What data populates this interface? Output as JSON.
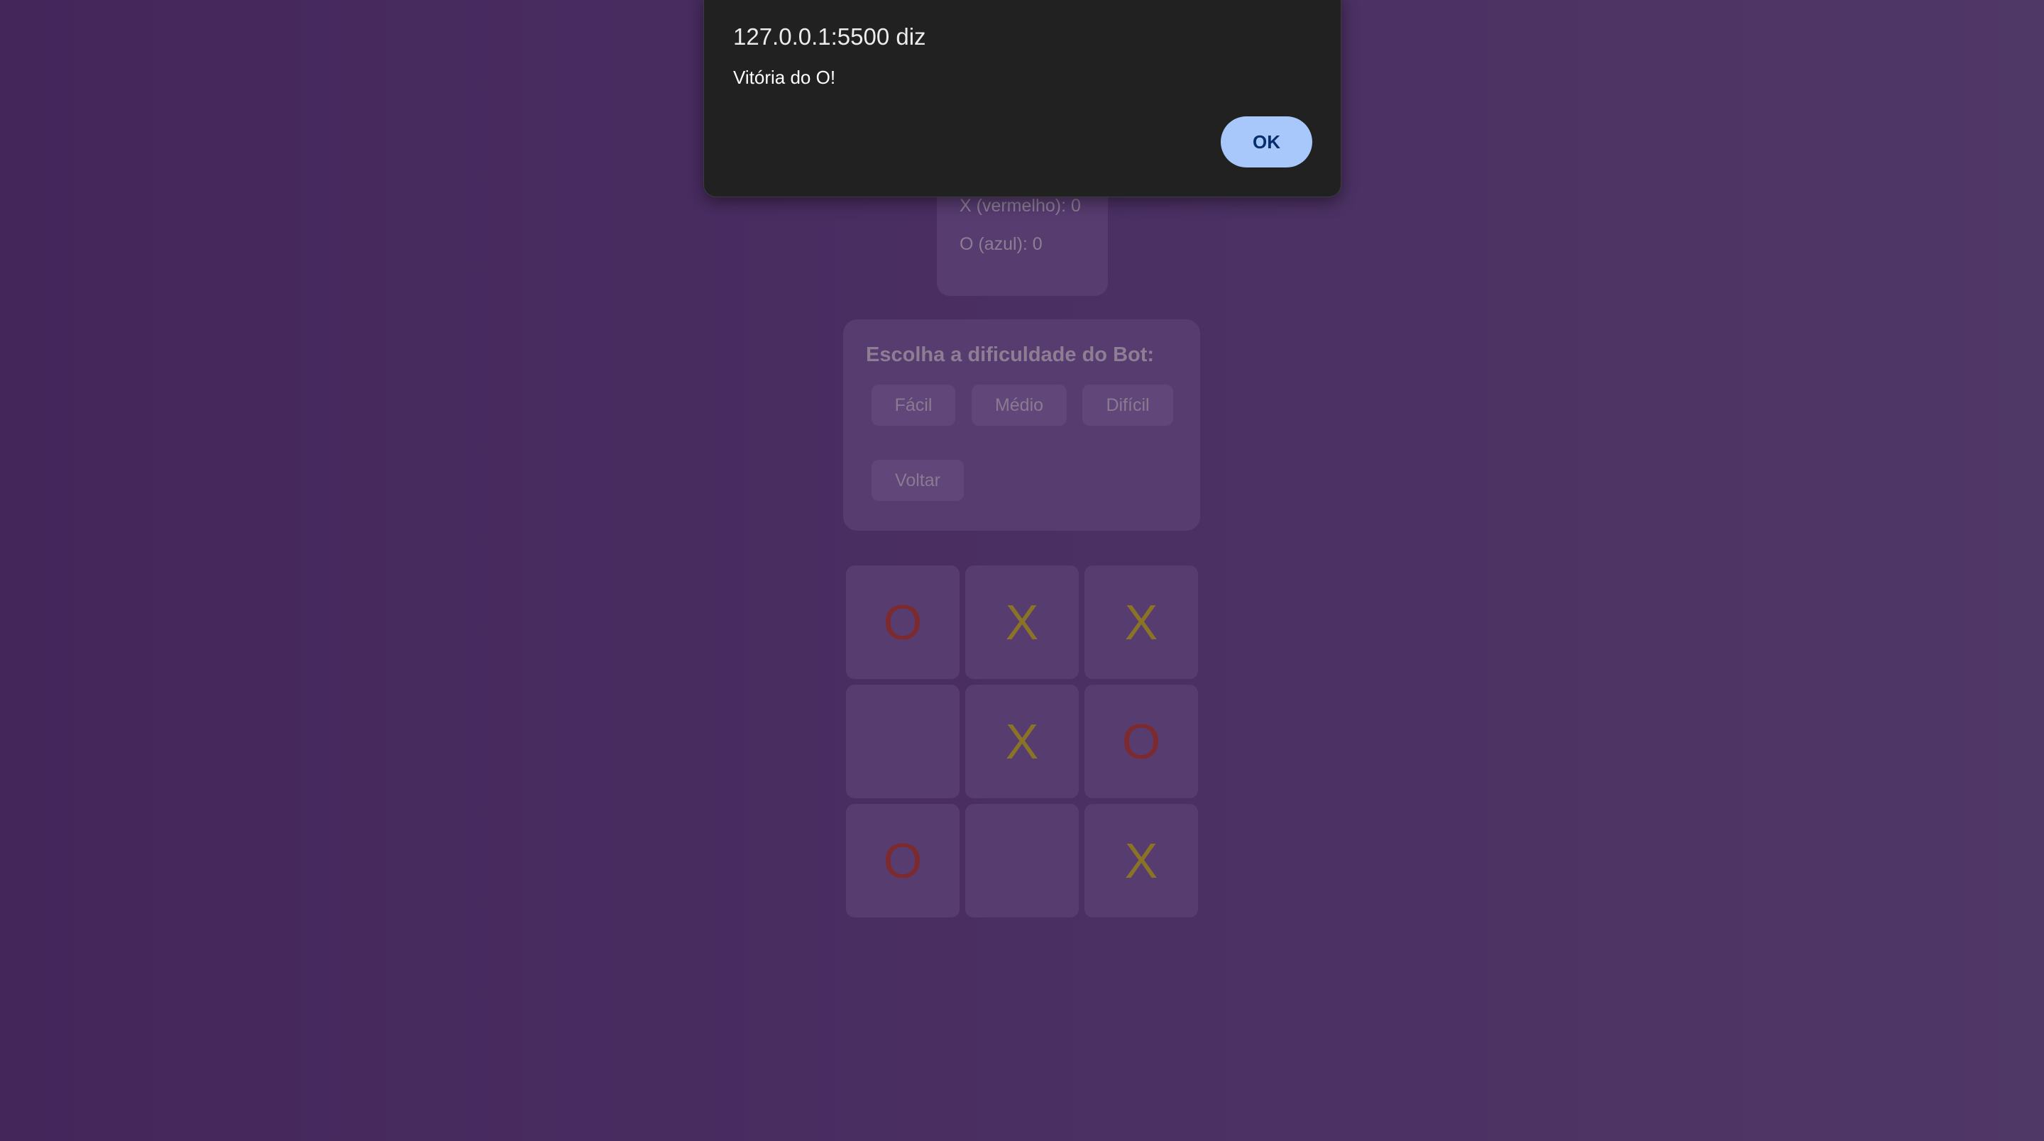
{
  "scoreboard": {
    "x_score": "X (vermelho): 0",
    "o_score": "O (azul): 0"
  },
  "difficulty": {
    "title": "Escolha a dificuldade do Bot:",
    "easy": "Fácil",
    "medium": "Médio",
    "hard": "Difícil",
    "back": "Voltar"
  },
  "board": {
    "cells": [
      "O",
      "X",
      "X",
      "",
      "X",
      "O",
      "O",
      "",
      "X"
    ]
  },
  "dialog": {
    "title": "127.0.0.1:5500 diz",
    "message": "Vitória do O!",
    "ok_label": "OK"
  },
  "colors": {
    "x_mark": "#8a7326",
    "o_mark": "#7d2a2f",
    "ok_button": "#a8c7fa"
  }
}
